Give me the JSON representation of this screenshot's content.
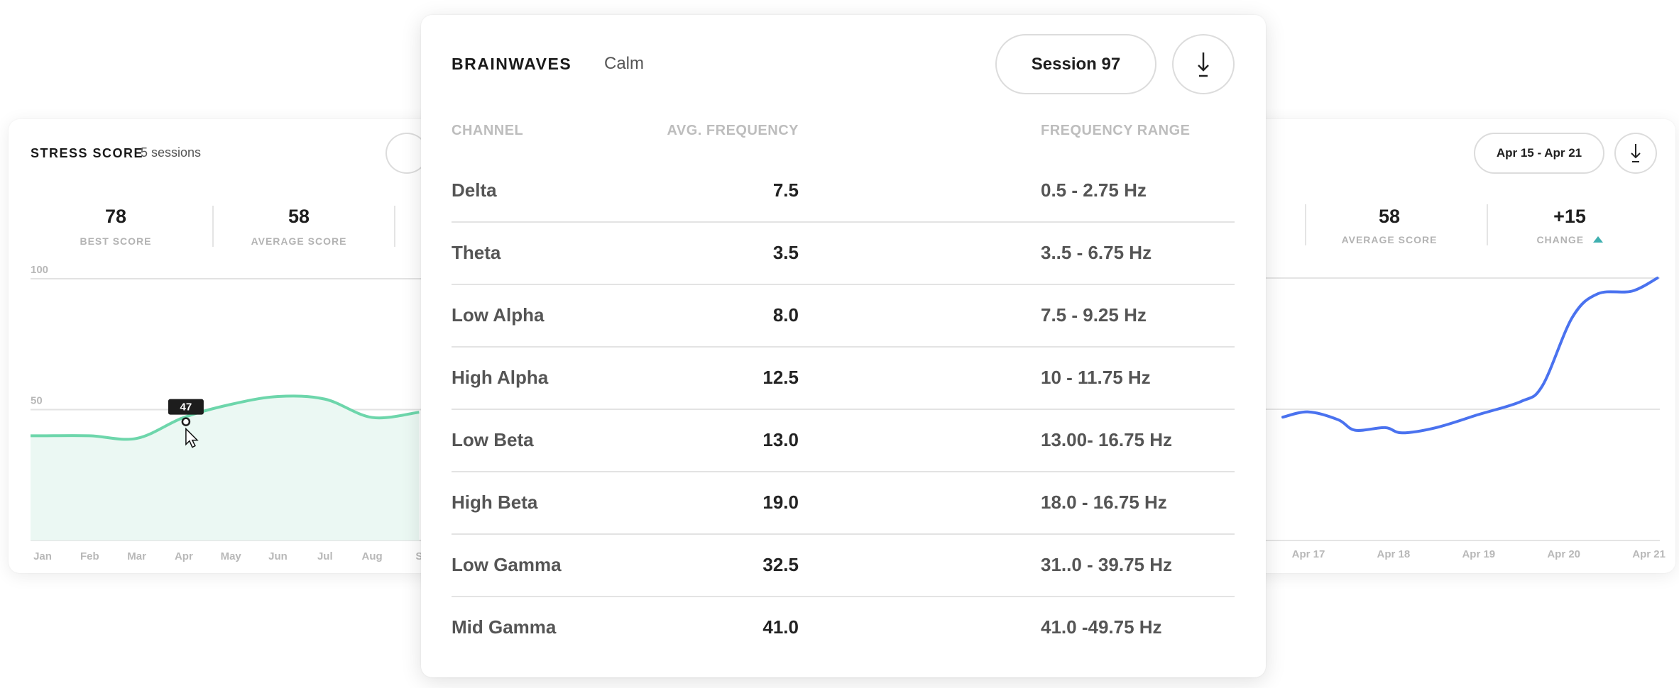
{
  "stress_card": {
    "title": "STRESS SCORE",
    "subtitle": "5 sessions",
    "stats": [
      {
        "value": "78",
        "label": "BEST SCORE"
      },
      {
        "value": "58",
        "label": "AVERAGE SCORE"
      }
    ],
    "tooltip": "47"
  },
  "weekly_card": {
    "date_range_label": "Apr 15 - Apr 21",
    "download_icon": "download-icon",
    "stats": [
      {
        "value": "58",
        "label": "AVERAGE SCORE"
      },
      {
        "value": "+15",
        "label": "CHANGE",
        "trend_icon": "triangle-up-icon",
        "trend_color": "#3fb0b0"
      }
    ]
  },
  "brainwaves": {
    "title": "BRAINWAVES",
    "subtitle": "Calm",
    "session_label": "Session 97",
    "download_icon": "download-icon",
    "columns": [
      "CHANNEL",
      "AVG. FREQUENCY",
      "FREQUENCY RANGE"
    ],
    "rows": [
      {
        "channel": "Delta",
        "avg": "7.5",
        "range": "0.5 - 2.75 Hz"
      },
      {
        "channel": "Theta",
        "avg": "3.5",
        "range": "3..5 - 6.75 Hz"
      },
      {
        "channel": "Low Alpha",
        "avg": "8.0",
        "range": "7.5 - 9.25 Hz"
      },
      {
        "channel": "High Alpha",
        "avg": "12.5",
        "range": "10 - 11.75 Hz"
      },
      {
        "channel": "Low Beta",
        "avg": "13.0",
        "range": "13.00- 16.75 Hz"
      },
      {
        "channel": "High Beta",
        "avg": "19.0",
        "range": "18.0 - 16.75 Hz"
      },
      {
        "channel": "Low Gamma",
        "avg": "32.5",
        "range": "31..0 - 39.75 Hz"
      },
      {
        "channel": "Mid Gamma",
        "avg": "41.0",
        "range": "41.0 -49.75 Hz"
      }
    ]
  },
  "chart_data": [
    {
      "type": "area",
      "categories": [
        "Jan",
        "Feb",
        "Mar",
        "Apr",
        "May",
        "Jun",
        "Jul",
        "Aug",
        "S"
      ],
      "values": [
        40,
        40,
        39,
        47,
        52,
        55,
        54,
        47,
        49
      ],
      "ylim": [
        0,
        100
      ],
      "yticks": [
        "0",
        "50",
        "100"
      ],
      "grid": true,
      "line_color": "#6dd6ab",
      "fill_color": "#ebf8f3",
      "highlight": {
        "category": "Apr",
        "value": 47
      }
    },
    {
      "type": "line",
      "x_labels": [
        "Apr 17",
        "Apr 18",
        "Apr 19",
        "Apr 20",
        "Apr 21"
      ],
      "x_ticks": [
        17,
        18,
        19,
        20,
        21
      ],
      "points": [
        {
          "x": 16.7,
          "y": 47
        },
        {
          "x": 17.0,
          "y": 49
        },
        {
          "x": 17.35,
          "y": 46
        },
        {
          "x": 17.55,
          "y": 42
        },
        {
          "x": 17.9,
          "y": 43
        },
        {
          "x": 18.1,
          "y": 41
        },
        {
          "x": 18.5,
          "y": 43
        },
        {
          "x": 19.0,
          "y": 48
        },
        {
          "x": 19.5,
          "y": 53
        },
        {
          "x": 19.75,
          "y": 59
        },
        {
          "x": 20.1,
          "y": 85
        },
        {
          "x": 20.4,
          "y": 94
        },
        {
          "x": 20.8,
          "y": 95
        },
        {
          "x": 21.1,
          "y": 100
        }
      ],
      "ylim": [
        0,
        100
      ],
      "grid": true,
      "line_color": "#4a72ef"
    }
  ]
}
